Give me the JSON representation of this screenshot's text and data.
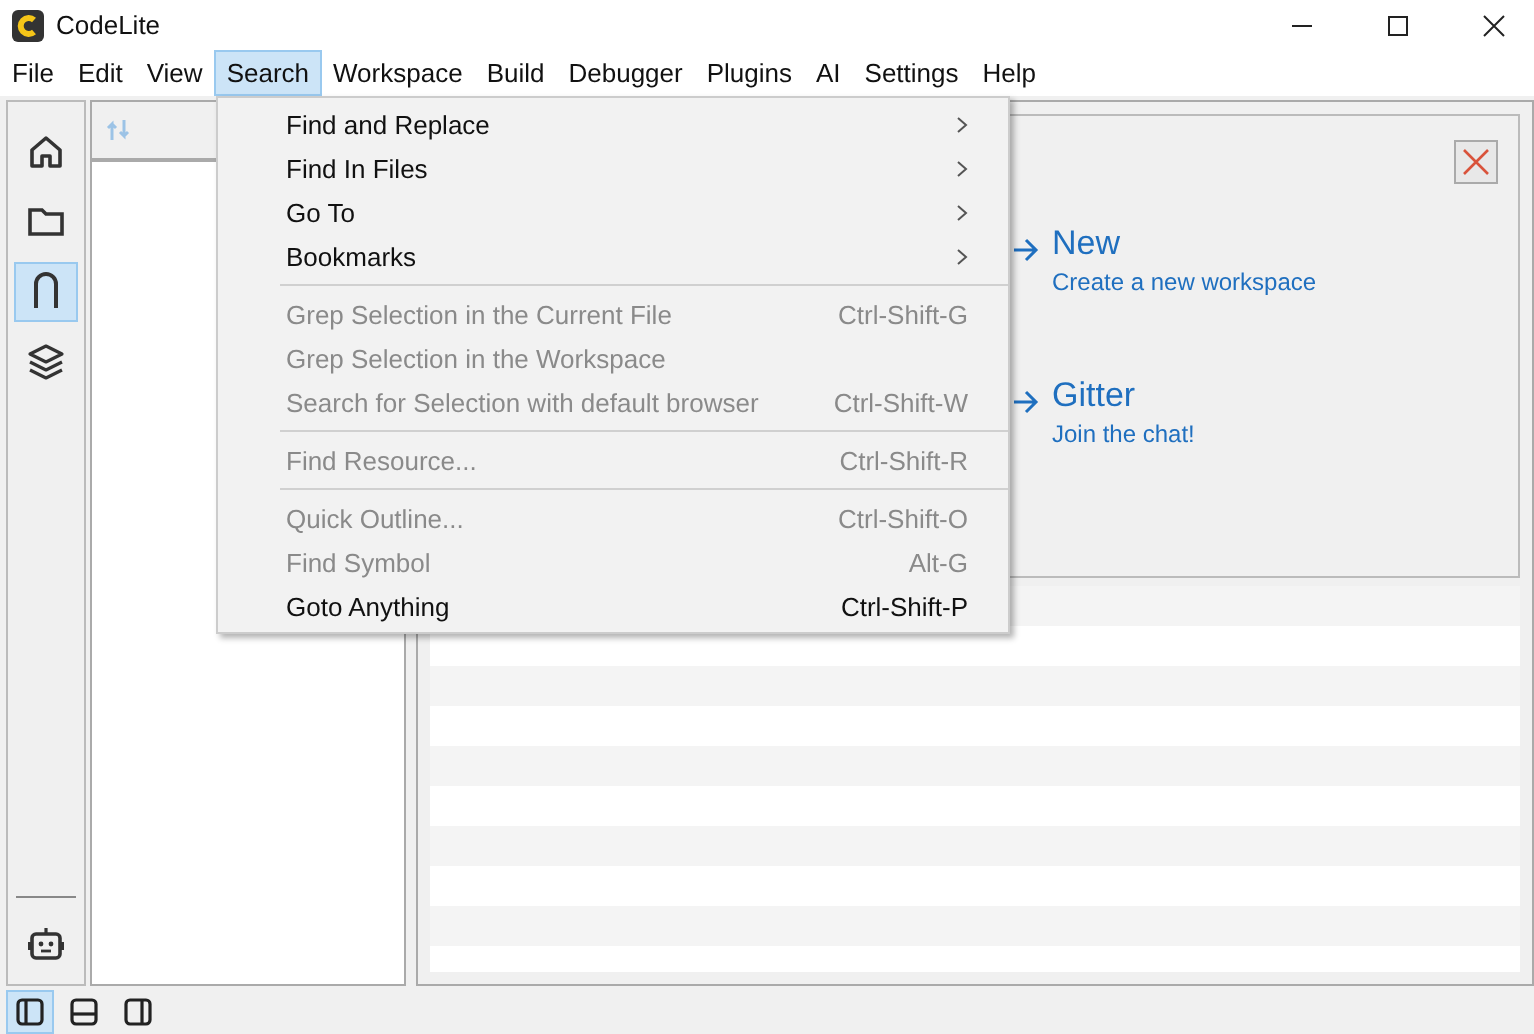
{
  "window": {
    "title": "CodeLite"
  },
  "menubar": [
    {
      "label": "File",
      "selected": false
    },
    {
      "label": "Edit",
      "selected": false
    },
    {
      "label": "View",
      "selected": false
    },
    {
      "label": "Search",
      "selected": true
    },
    {
      "label": "Workspace",
      "selected": false
    },
    {
      "label": "Build",
      "selected": false
    },
    {
      "label": "Debugger",
      "selected": false
    },
    {
      "label": "Plugins",
      "selected": false
    },
    {
      "label": "AI",
      "selected": false
    },
    {
      "label": "Settings",
      "selected": false
    },
    {
      "label": "Help",
      "selected": false
    }
  ],
  "sidebar": {
    "items": [
      {
        "kind": "home",
        "selected": false
      },
      {
        "kind": "folder",
        "selected": false
      },
      {
        "kind": "branch",
        "selected": true
      },
      {
        "kind": "layers",
        "selected": false
      }
    ]
  },
  "search_menu": [
    {
      "kind": "submenu",
      "label": "Find and Replace",
      "disabled": false
    },
    {
      "kind": "submenu",
      "label": "Find In Files",
      "disabled": false
    },
    {
      "kind": "submenu",
      "label": "Go To",
      "disabled": false
    },
    {
      "kind": "submenu",
      "label": "Bookmarks",
      "disabled": false
    },
    {
      "kind": "separator"
    },
    {
      "kind": "command",
      "label": "Grep Selection in the Current File",
      "shortcut": "Ctrl-Shift-G",
      "disabled": true
    },
    {
      "kind": "command",
      "label": "Grep Selection in the Workspace",
      "disabled": true
    },
    {
      "kind": "command",
      "label": "Search for Selection with default browser",
      "shortcut": "Ctrl-Shift-W",
      "disabled": true
    },
    {
      "kind": "separator"
    },
    {
      "kind": "command",
      "label": "Find Resource...",
      "shortcut": "Ctrl-Shift-R",
      "disabled": true
    },
    {
      "kind": "separator"
    },
    {
      "kind": "command",
      "label": "Quick Outline...",
      "shortcut": "Ctrl-Shift-O",
      "disabled": true
    },
    {
      "kind": "command",
      "label": "Find Symbol",
      "shortcut": "Alt-G",
      "disabled": true
    },
    {
      "kind": "command",
      "label": "Goto Anything",
      "shortcut": "Ctrl-Shift-P",
      "disabled": false
    }
  ],
  "welcome": {
    "links": [
      {
        "title": "New",
        "subtitle": "Create a new workspace"
      },
      {
        "title": "Gitter",
        "subtitle": "Join the chat!"
      }
    ]
  },
  "layout_buttons": [
    {
      "kind": "left",
      "selected": true
    },
    {
      "kind": "bottom",
      "selected": false
    },
    {
      "kind": "right",
      "selected": false
    }
  ]
}
